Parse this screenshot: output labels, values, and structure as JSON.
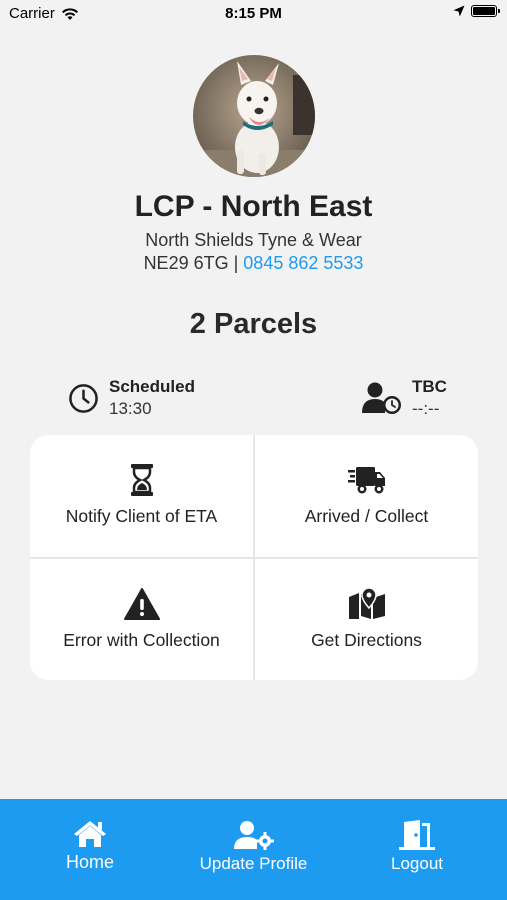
{
  "status_bar": {
    "carrier": "Carrier",
    "time": "8:15 PM"
  },
  "profile": {
    "avatar_icon": "dog-avatar-image",
    "name": "LCP - North East",
    "address": "North Shields Tyne & Wear",
    "postcode": "NE29 6TG",
    "separator": " | ",
    "phone": "0845 862 5533",
    "phone_color": "#1d9bf0"
  },
  "parcels": "2 Parcels",
  "schedule": {
    "icon": "clock-icon",
    "label": "Scheduled",
    "value": "13:30"
  },
  "tbc": {
    "icon": "user-clock-icon",
    "label": "TBC",
    "value": "--:--"
  },
  "actions": {
    "notify": {
      "label": "Notify Client of ETA",
      "icon": "hourglass-icon"
    },
    "arrived": {
      "label": "Arrived / Collect",
      "icon": "truck-icon"
    },
    "error": {
      "label": "Error with Collection",
      "icon": "warning-icon"
    },
    "directions": {
      "label": "Get Directions",
      "icon": "map-icon"
    }
  },
  "tabbar": {
    "color": "#1d9bf0",
    "home": {
      "label": "Home",
      "icon": "home-icon"
    },
    "profile": {
      "label": "Update Profile",
      "icon": "user-cog-icon"
    },
    "logout": {
      "label": "Logout",
      "icon": "door-icon"
    }
  }
}
